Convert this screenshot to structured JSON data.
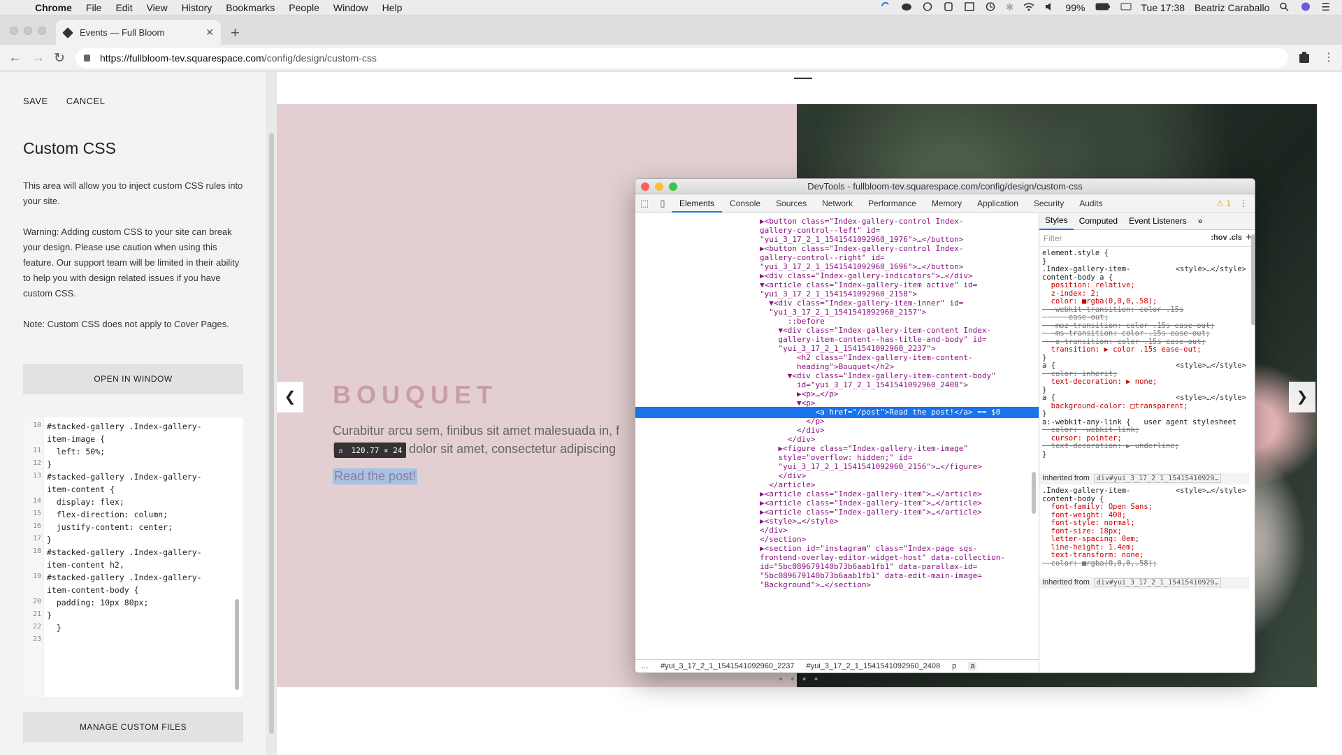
{
  "menubar": {
    "app": "Chrome",
    "items": [
      "File",
      "Edit",
      "View",
      "History",
      "Bookmarks",
      "People",
      "Window",
      "Help"
    ],
    "battery": "99%",
    "clock": "Tue 17:38",
    "user": "Beatriz Caraballo"
  },
  "browser": {
    "tab_title": "Events — Full Bloom",
    "url_host": "https://fullbloom-tev.squarespace.com",
    "url_path": "/config/design/custom-css"
  },
  "panel": {
    "save_label": "SAVE",
    "cancel_label": "CANCEL",
    "title": "Custom CSS",
    "intro": "This area will allow you to inject custom CSS rules into your site.",
    "warning": "Warning: Adding custom CSS to your site can break your design. Please use caution when using this feature. Our support team will be limited in their ability to help you with design related issues if you have custom CSS.",
    "note": "Note: Custom CSS does not apply to Cover Pages.",
    "open_window_label": "OPEN IN WINDOW",
    "manage_files_label": "MANAGE CUSTOM FILES",
    "code_lines": [
      {
        "num": "10",
        "text": "#stacked-gallery .Index-gallery-"
      },
      {
        "num": "",
        "text": "item-image {"
      },
      {
        "num": "11",
        "text": "  left: 50%;"
      },
      {
        "num": "12",
        "text": "}"
      },
      {
        "num": "13",
        "text": "#stacked-gallery .Index-gallery-"
      },
      {
        "num": "",
        "text": "item-content {"
      },
      {
        "num": "14",
        "text": "  display: flex;"
      },
      {
        "num": "15",
        "text": "  flex-direction: column;"
      },
      {
        "num": "16",
        "text": "  justify-content: center;"
      },
      {
        "num": "17",
        "text": "}"
      },
      {
        "num": "18",
        "text": "#stacked-gallery .Index-gallery-"
      },
      {
        "num": "",
        "text": "item-content h2,"
      },
      {
        "num": "19",
        "text": "#stacked-gallery .Index-gallery-"
      },
      {
        "num": "",
        "text": "item-content-body {"
      },
      {
        "num": "20",
        "text": "  padding: 10px 80px;"
      },
      {
        "num": "21",
        "text": "}"
      },
      {
        "num": "22",
        "text": "  }"
      },
      {
        "num": "23",
        "text": ""
      }
    ]
  },
  "preview": {
    "heading": "BOUQUET",
    "body_line1": "Curabitur arcu sem, finibus sit amet malesuada in, f",
    "body_line2": "Lorem ipsum dolor sit amet, consectetur adipiscing",
    "link": "Read the post!",
    "tooltip_tag": "a",
    "tooltip_size": "120.77 × 24",
    "prev_arrow": "❮",
    "next_arrow": "❯"
  },
  "devtools": {
    "title": "DevTools - fullbloom-tev.squarespace.com/config/design/custom-css",
    "tabs": [
      "Elements",
      "Console",
      "Sources",
      "Network",
      "Performance",
      "Memory",
      "Application",
      "Security",
      "Audits"
    ],
    "warning_count": "1",
    "elements_lines": [
      "▶<button class=\"Index-gallery-control Index-",
      "gallery-control--left\" id=",
      "\"yui_3_17_2_1_1541541092960_1976\">…</button>",
      "▶<button class=\"Index-gallery-control Index-",
      "gallery-control--right\" id=",
      "\"yui_3_17_2_1_1541541092960_1696\">…</button>",
      "▶<div class=\"Index-gallery-indicators\">…</div>",
      "▼<article class=\"Index-gallery-item active\" id=",
      "\"yui_3_17_2_1_1541541092960_2158\">",
      "  ▼<div class=\"Index-gallery-item-inner\" id=",
      "  \"yui_3_17_2_1_1541541092960_2157\">",
      "      ::before",
      "    ▼<div class=\"Index-gallery-item-content Index-",
      "    gallery-item-content--has-title-and-body\" id=",
      "    \"yui_3_17_2_1_1541541092960_2237\">",
      "        <h2 class=\"Index-gallery-item-content-",
      "        heading\">Bouquet</h2>",
      "      ▼<div class=\"Index-gallery-item-content-body\"",
      "        id=\"yui_3_17_2_1_1541541092960_2408\">",
      "        ▶<p>…</p>",
      "        ▼<p>",
      "            <a href=\"/post\">Read the post!</a> == $0",
      "          </p>",
      "        </div>",
      "      </div>",
      "    ▶<figure class=\"Index-gallery-item-image\"",
      "    style=\"overflow: hidden;\" id=",
      "    \"yui_3_17_2_1_1541541092960_2156\">…</figure>",
      "    </div>",
      "  </article>",
      "▶<article class=\"Index-gallery-item\">…</article>",
      "▶<article class=\"Index-gallery-item\">…</article>",
      "▶<article class=\"Index-gallery-item\">…</article>",
      "▶<style>…</style>",
      "</div>",
      "</section>",
      "▶<section id=\"instagram\" class=\"Index-page sqs-",
      "frontend-overlay-editor-widget-host\" data-collection-",
      "id=\"5bc089679140b73b6aab1fb1\" data-parallax-id=",
      "\"5bc089679140b73b6aab1fb1\" data-edit-main-image=",
      "\"Background\">…</section>"
    ],
    "selected_line_index": 21,
    "breadcrumbs": [
      "…",
      "#yui_3_17_2_1_1541541092960_2237",
      "#yui_3_17_2_1_1541541092960_2408",
      "p",
      "a"
    ],
    "styles_tabs": [
      "Styles",
      "Computed",
      "Event Listeners",
      "»"
    ],
    "filter_placeholder": "Filter",
    "filter_opts": ":hov  .cls",
    "style_lines": [
      {
        "text": "element.style {",
        "kind": "sel"
      },
      {
        "text": "}",
        "kind": "sel"
      },
      {
        "text": ".Index-gallery-item-",
        "kind": "sel",
        "src": "<style>…</style>"
      },
      {
        "text": "content-body a {",
        "kind": "sel"
      },
      {
        "text": "  position: relative;",
        "kind": "prop"
      },
      {
        "text": "  z-index: 2;",
        "kind": "prop"
      },
      {
        "text": "  color: ■rgba(0,0,0,.58);",
        "kind": "prop"
      },
      {
        "text": "  -webkit-transition: color .15s",
        "kind": "strike"
      },
      {
        "text": "      ease-out;",
        "kind": "strike"
      },
      {
        "text": "  -moz-transition: color .15s ease-out;",
        "kind": "strike"
      },
      {
        "text": "  -ms-transition: color .15s ease-out;",
        "kind": "strike"
      },
      {
        "text": "  -o-transition: color .15s ease-out;",
        "kind": "strike"
      },
      {
        "text": "  transition: ▶ color .15s ease-out;",
        "kind": "prop"
      },
      {
        "text": "}",
        "kind": "sel"
      },
      {
        "text": "a {",
        "kind": "sel",
        "src": "<style>…</style>"
      },
      {
        "text": "  color: inherit;",
        "kind": "strike"
      },
      {
        "text": "  text-decoration: ▶ none;",
        "kind": "prop"
      },
      {
        "text": "}",
        "kind": "sel"
      },
      {
        "text": "a {",
        "kind": "sel",
        "src": "<style>…</style>"
      },
      {
        "text": "  background-color: □transparent;",
        "kind": "prop"
      },
      {
        "text": "}",
        "kind": "sel"
      },
      {
        "text": "a:-webkit-any-link {   user agent stylesheet",
        "kind": "sel"
      },
      {
        "text": "  color: -webkit-link;",
        "kind": "strike"
      },
      {
        "text": "  cursor: pointer;",
        "kind": "prop"
      },
      {
        "text": "  text-decoration: ▶ underline;",
        "kind": "strike"
      },
      {
        "text": "}",
        "kind": "sel"
      }
    ],
    "inherited_label": "Inherited from",
    "inherited_target": "div#yui_3_17_2_1_15415410929…",
    "style_lines2": [
      {
        "text": ".Index-gallery-item-",
        "kind": "sel",
        "src": "<style>…</style>"
      },
      {
        "text": "content-body {",
        "kind": "sel"
      },
      {
        "text": "  font-family: Open Sans;",
        "kind": "prop"
      },
      {
        "text": "  font-weight: 400;",
        "kind": "prop"
      },
      {
        "text": "  font-style: normal;",
        "kind": "prop"
      },
      {
        "text": "  font-size: 18px;",
        "kind": "prop"
      },
      {
        "text": "  letter-spacing: 0em;",
        "kind": "prop"
      },
      {
        "text": "  line-height: 1.4em;",
        "kind": "prop"
      },
      {
        "text": "  text-transform: none;",
        "kind": "prop"
      },
      {
        "text": "  color: ■rgba(0,0,0,.58);",
        "kind": "strike"
      }
    ]
  }
}
